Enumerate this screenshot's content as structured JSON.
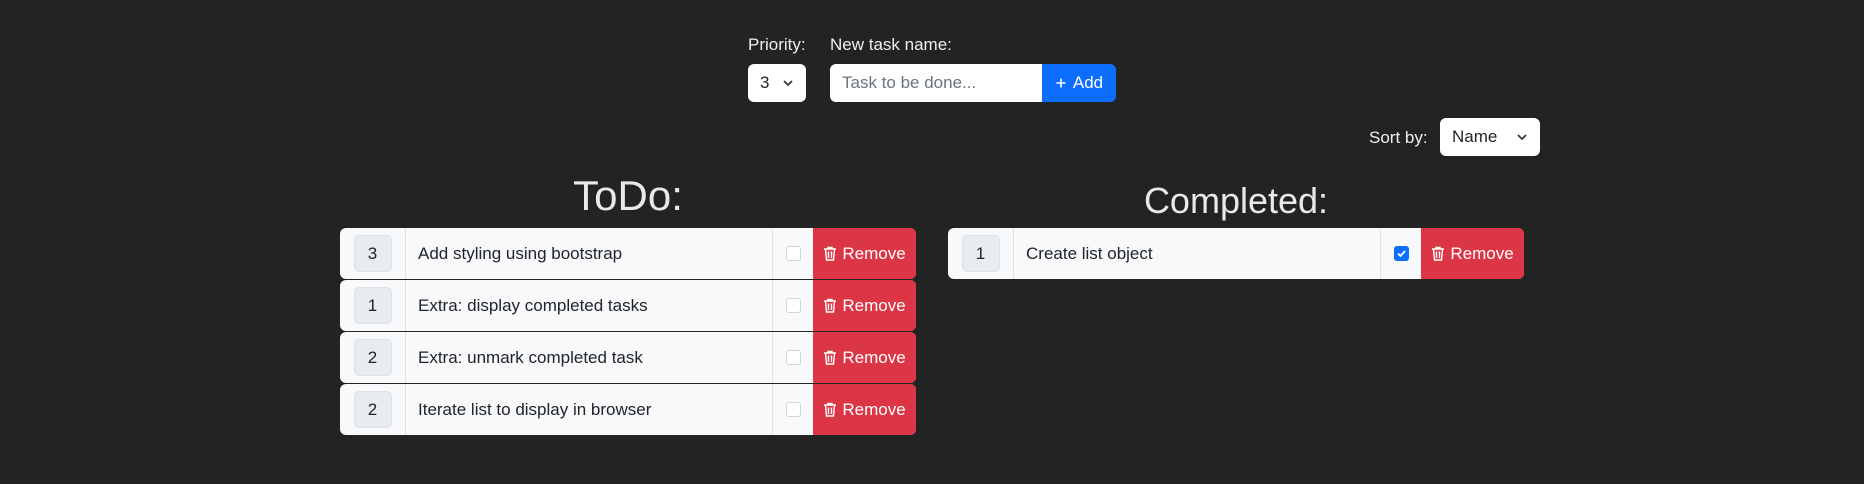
{
  "form": {
    "priority_label": "Priority:",
    "priority_value": "3",
    "task_label": "New task name:",
    "task_placeholder": "Task to be done...",
    "task_value": "",
    "add_label": "Add",
    "add_icon": "plus-icon"
  },
  "sort": {
    "label": "Sort by:",
    "value": "Name"
  },
  "todo": {
    "title": "ToDo:",
    "items": [
      {
        "priority": "3",
        "name": "Add styling using bootstrap",
        "checked": false,
        "remove": "Remove"
      },
      {
        "priority": "1",
        "name": "Extra: display completed tasks",
        "checked": false,
        "remove": "Remove"
      },
      {
        "priority": "2",
        "name": "Extra: unmark completed task",
        "checked": false,
        "remove": "Remove"
      },
      {
        "priority": "2",
        "name": "Iterate list to display in browser",
        "checked": false,
        "remove": "Remove"
      }
    ]
  },
  "completed": {
    "title": "Completed:",
    "items": [
      {
        "priority": "1",
        "name": "Create list object",
        "checked": true,
        "remove": "Remove"
      }
    ]
  },
  "colors": {
    "background": "#232323",
    "primary": "#0d6efd",
    "danger": "#dc3545",
    "row_bg": "#f8f9fa"
  }
}
